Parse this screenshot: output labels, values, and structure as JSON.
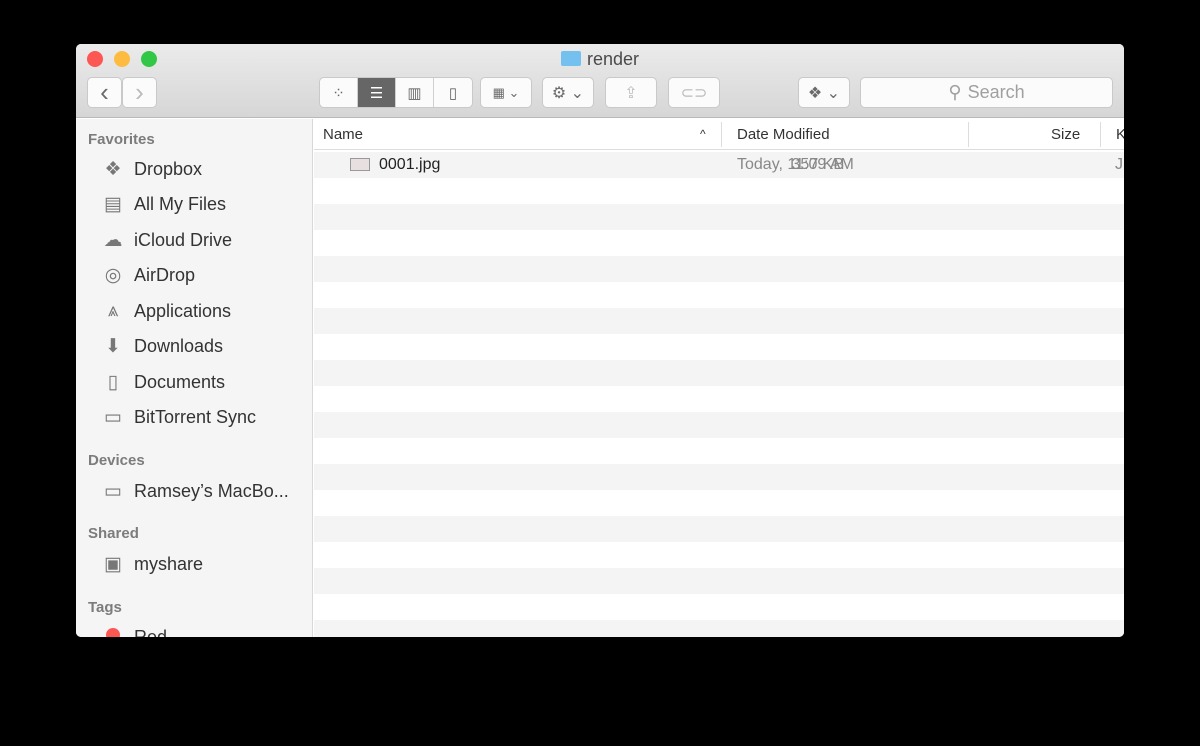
{
  "window": {
    "title": "render"
  },
  "toolbar": {
    "back": "‹",
    "forward": "›",
    "search_placeholder": "Search"
  },
  "sidebar": {
    "favorites_label": "Favorites",
    "favorites": [
      {
        "label": "Dropbox",
        "icon": "dropbox-icon",
        "g": "❖"
      },
      {
        "label": "All My Files",
        "icon": "all-files-icon",
        "g": "▤"
      },
      {
        "label": "iCloud Drive",
        "icon": "cloud-icon",
        "g": "☁"
      },
      {
        "label": "AirDrop",
        "icon": "airdrop-icon",
        "g": "◎"
      },
      {
        "label": "Applications",
        "icon": "applications-icon",
        "g": "⩓"
      },
      {
        "label": "Downloads",
        "icon": "downloads-icon",
        "g": "⬇"
      },
      {
        "label": "Documents",
        "icon": "documents-icon",
        "g": "▯"
      },
      {
        "label": "BitTorrent Sync",
        "icon": "folder-icon",
        "g": "▭"
      }
    ],
    "devices_label": "Devices",
    "devices": [
      {
        "label": "Ramsey’s MacBo...",
        "icon": "laptop-icon",
        "g": "▭"
      }
    ],
    "shared_label": "Shared",
    "shared": [
      {
        "label": "myshare",
        "icon": "monitor-icon",
        "g": "▣"
      }
    ],
    "tags_label": "Tags",
    "tags": [
      {
        "label": "Red",
        "color": "#fc5753"
      }
    ]
  },
  "columns": {
    "name": "Name",
    "date": "Date Modified",
    "size": "Size",
    "kind": "K"
  },
  "files": [
    {
      "name": "0001.jpg",
      "date": "Today, 11:09 AM",
      "size": "357 KB",
      "kind": "J"
    }
  ]
}
